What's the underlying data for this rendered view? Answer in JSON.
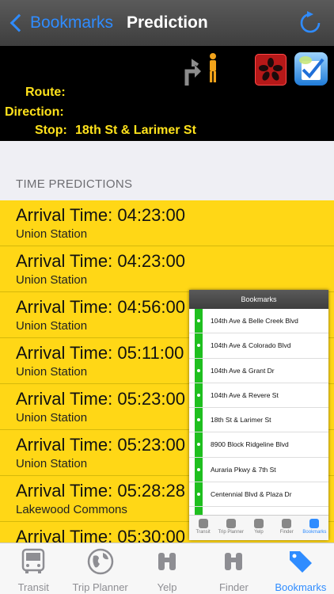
{
  "nav": {
    "back_label": "Bookmarks",
    "title": "Prediction"
  },
  "info": {
    "route_label": "Route:",
    "route_value": "",
    "direction_label": "Direction:",
    "direction_value": "",
    "stop_label": "Stop:",
    "stop_value": "18th St & Larimer St",
    "text_color": "#ffe21c"
  },
  "section": {
    "title": "TIME PREDICTIONS"
  },
  "predictions": [
    {
      "time": "Arrival Time: 04:23:00",
      "destination": "Union Station"
    },
    {
      "time": "Arrival Time: 04:23:00",
      "destination": "Union Station"
    },
    {
      "time": "Arrival Time: 04:56:00",
      "destination": "Union Station"
    },
    {
      "time": "Arrival Time: 05:11:00",
      "destination": "Union Station"
    },
    {
      "time": "Arrival Time: 05:23:00",
      "destination": "Union Station"
    },
    {
      "time": "Arrival Time: 05:23:00",
      "destination": "Union Station"
    },
    {
      "time": "Arrival Time: 05:28:28",
      "destination": "Lakewood Commons"
    },
    {
      "time": "Arrival Time: 05:30:00",
      "destination": ""
    }
  ],
  "bookmarks_preview": {
    "title": "Bookmarks",
    "items": [
      "104th Ave & Belle Creek Blvd",
      "104th Ave & Colorado Blvd",
      "104th Ave & Grant Dr",
      "104th Ave & Revere St",
      "18th St & Larimer St",
      "8900 Block Ridgeline Blvd",
      "Auraria Pkwy & 7th St",
      "Centennial Blvd & Plaza Dr"
    ],
    "tabs": [
      "Transit",
      "Trip Planner",
      "Yelp",
      "Finder",
      "Bookmarks"
    ]
  },
  "tabbar": {
    "tabs": [
      {
        "label": "Transit",
        "icon": "bus-icon"
      },
      {
        "label": "Trip Planner",
        "icon": "globe-icon"
      },
      {
        "label": "Yelp",
        "icon": "binoculars-icon"
      },
      {
        "label": "Finder",
        "icon": "binoculars-icon"
      },
      {
        "label": "Bookmarks",
        "icon": "tag-icon"
      }
    ],
    "active_tab": "Bookmarks",
    "active_color": "#2f8cff"
  },
  "colors": {
    "row_background": "#ffd716",
    "accent": "#2f8cff"
  }
}
